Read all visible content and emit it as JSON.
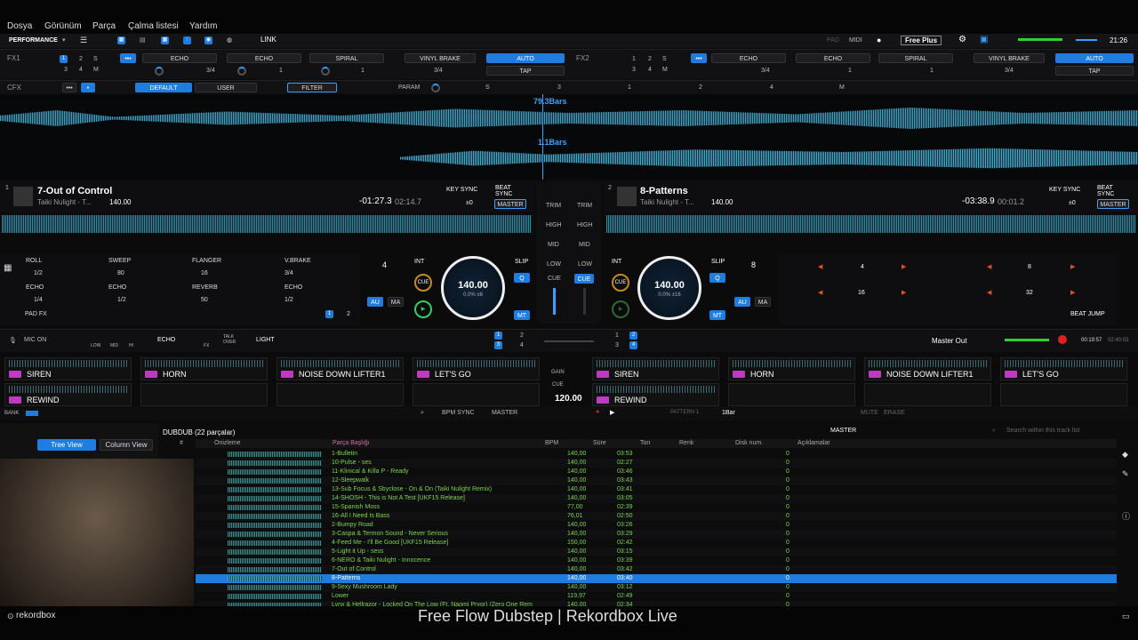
{
  "menu": {
    "items": [
      "Dosya",
      "Görünüm",
      "Parça",
      "Çalma listesi",
      "Yardım"
    ]
  },
  "toolbar": {
    "mode": "PERFORMANCE",
    "link": "LINK",
    "pad": "PAD",
    "midi": "MIDI",
    "plan": "Free Plus",
    "clock": "21:26"
  },
  "fx1": {
    "label": "FX1",
    "nums": [
      "1",
      "2",
      "S",
      "3",
      "4",
      "M"
    ],
    "slots": [
      "ECHO",
      "ECHO",
      "SPIRAL"
    ],
    "beat": [
      "1",
      "1",
      "1"
    ],
    "brake": "VINYL BRAKE",
    "brake_beat": "3/4",
    "auto": "AUTO",
    "tap": "TAP",
    "frac": "3/4"
  },
  "fx2": {
    "label": "FX2",
    "nums": [
      "1",
      "2",
      "S",
      "3",
      "4",
      "M"
    ],
    "slots": [
      "ECHO",
      "ECHO",
      "SPIRAL"
    ],
    "beat": [
      "1",
      "1",
      "1"
    ],
    "brake": "VINYL BRAKE",
    "brake_beat": "3/4",
    "auto": "AUTO",
    "tap": "TAP",
    "frac": "3/4"
  },
  "cfx": {
    "label": "CFX",
    "default": "DEFAULT",
    "user": "USER",
    "filter": "FILTER",
    "param": "PARAM",
    "s": "S",
    "m": "M",
    "nums": [
      "3",
      "1",
      "2",
      "4"
    ]
  },
  "overview": {
    "bars1": "79.3Bars",
    "bars2": "1.1Bars"
  },
  "deck1": {
    "num": "1",
    "title": "7-Out of Control",
    "artist": "Taiki Nulight - T...",
    "bpm": "140.00",
    "remain": "-01:27.3",
    "elapsed": "02:14.7",
    "keysync": "KEY SYNC",
    "beatsync": "BEAT SYNC",
    "key": "±0",
    "master": "MASTER",
    "jog_bpm": "140.00",
    "jog_pct": "0.0% ±6",
    "int": "INT",
    "slip": "SLIP",
    "loop": "4",
    "cue": "CUE",
    "au": "AU",
    "ma": "MA",
    "mt": "MT",
    "q": "Q"
  },
  "deck2": {
    "num": "2",
    "title": "8-Patterns",
    "artist": "Taiki Nulight - T...",
    "bpm": "140.00",
    "remain": "-03:38.9",
    "elapsed": "00:01.2",
    "keysync": "KEY SYNC",
    "beatsync": "BEAT SYNC",
    "key": "±0",
    "master": "MASTER",
    "jog_bpm": "140.00",
    "jog_pct": "0.0% ±16",
    "int": "INT",
    "slip": "SLIP",
    "loop": "8",
    "cue": "CUE",
    "au": "AU",
    "ma": "MA",
    "mt": "MT",
    "q": "Q"
  },
  "mixer": {
    "trim": "TRIM",
    "high": "HIGH",
    "mid": "MID",
    "low": "LOW",
    "cue": "CUE",
    "gain": "GAIN"
  },
  "padfx": {
    "cells": [
      {
        "name": "ROLL",
        "val": "1/2"
      },
      {
        "name": "SWEEP",
        "val": "80"
      },
      {
        "name": "FLANGER",
        "val": "16"
      },
      {
        "name": "V.BRAKE",
        "val": "3/4"
      },
      {
        "name": "ECHO",
        "val": "1/4"
      },
      {
        "name": "ECHO",
        "val": "1/2"
      },
      {
        "name": "REVERB",
        "val": "50"
      },
      {
        "name": "ECHO",
        "val": "1/2"
      }
    ],
    "label": "PAD FX",
    "p1": "1",
    "p2": "2"
  },
  "beatjump": {
    "label": "BEAT JUMP",
    "vals": [
      "4",
      "8",
      "16",
      "32"
    ]
  },
  "mic": {
    "label": "MIC ON",
    "low": "LOW",
    "mid": "MID",
    "hi": "HI",
    "echo": "ECHO",
    "fx": "FX",
    "talk": "TALK OVER",
    "light": "LIGHT",
    "master_out": "Master Out",
    "time1": "00:19:57",
    "time2": "02:40:03",
    "deck_nums": [
      "1",
      "2",
      "3",
      "4"
    ]
  },
  "samplers": {
    "left": [
      "SIREN",
      "HORN",
      "NOISE DOWN LIFTER1",
      "LET'S GO",
      "REWIND"
    ],
    "right": [
      "SIREN",
      "HORN",
      "NOISE DOWN LIFTER1",
      "LET'S GO",
      "REWIND"
    ],
    "bank": "BANK",
    "bpm_sync": "BPM SYNC",
    "master": "MASTER",
    "bpm": "120.00",
    "pattern": "PATTERN 1",
    "bar": "1Bar",
    "mute": "MUTE",
    "erase": "ERASE"
  },
  "browser": {
    "playlist": "DUBDUB (22 parçalar)",
    "tree": "Tree View",
    "column": "Column View",
    "master": "MASTER",
    "search_placeholder": "Search within this track list",
    "headers": [
      "#",
      "Önizleme",
      "Parça Başlığı",
      "BPM",
      "Süre",
      "Ton",
      "Renk",
      "Disk num.",
      "Açıklamalar"
    ],
    "rows": [
      {
        "t": "1-Bulletin",
        "bpm": "140,00",
        "len": "03:53",
        "disk": "0"
      },
      {
        "t": "10-Pulse - ses",
        "bpm": "140,00",
        "len": "02:27",
        "disk": "0"
      },
      {
        "t": "11-Klinical & Killa P - Ready",
        "bpm": "140,00",
        "len": "03:46",
        "disk": "0"
      },
      {
        "t": "12-Sleepwalk",
        "bpm": "140,00",
        "len": "03:43",
        "disk": "0"
      },
      {
        "t": "13-Sub Focus & Sbyclose - On & On (Taiki Nulight Remix)",
        "bpm": "140,00",
        "len": "03:41",
        "disk": "0"
      },
      {
        "t": "14-SHOSH - This is Not A Test [UKF15 Release]",
        "bpm": "140,00",
        "len": "03:05",
        "disk": "0"
      },
      {
        "t": "15-Spanish Moss",
        "bpm": "77,00",
        "len": "02:39",
        "disk": "0"
      },
      {
        "t": "16-All I Need Is Bass",
        "bpm": "76,01",
        "len": "02:50",
        "disk": "0"
      },
      {
        "t": "2-Bumpy Road",
        "bpm": "140,00",
        "len": "03:26",
        "disk": "0"
      },
      {
        "t": "3-Caspa & Termon Sound - Never Serious",
        "bpm": "140,00",
        "len": "03:29",
        "disk": "0"
      },
      {
        "t": "4-Feed Me - I'll Be Good [UKF15 Release]",
        "bpm": "150,00",
        "len": "02:42",
        "disk": "0"
      },
      {
        "t": "5-Light it Up - sess",
        "bpm": "140,00",
        "len": "03:15",
        "disk": "0"
      },
      {
        "t": "6-NERO & Taiki Nulight - Innocence",
        "bpm": "140,00",
        "len": "03:39",
        "disk": "0"
      },
      {
        "t": "7-Out of Control",
        "bpm": "140,00",
        "len": "03:42",
        "disk": "0"
      },
      {
        "t": "8-Patterns",
        "bpm": "140,00",
        "len": "03:40",
        "disk": "0"
      },
      {
        "t": "9-Sexy Mushroom Lady",
        "bpm": "140,00",
        "len": "03:12",
        "disk": "0"
      },
      {
        "t": "Lower",
        "bpm": "119,97",
        "len": "02:49",
        "disk": "0"
      },
      {
        "t": "Lynx & Hellrazor - Locked On The Low (Ft. Naomi Pryor) (Zero One Rem",
        "bpm": "140,00",
        "len": "02:34",
        "disk": "0"
      }
    ],
    "cue_mark": "CUE",
    "num2": "2"
  },
  "footer": {
    "logo": "rekordbox",
    "caption": "Free Flow Dubstep | Rekordbox Live"
  },
  "colors": {
    "accent": "#1f7de0",
    "wave": "#34c8e8",
    "green": "#7ad64a"
  }
}
